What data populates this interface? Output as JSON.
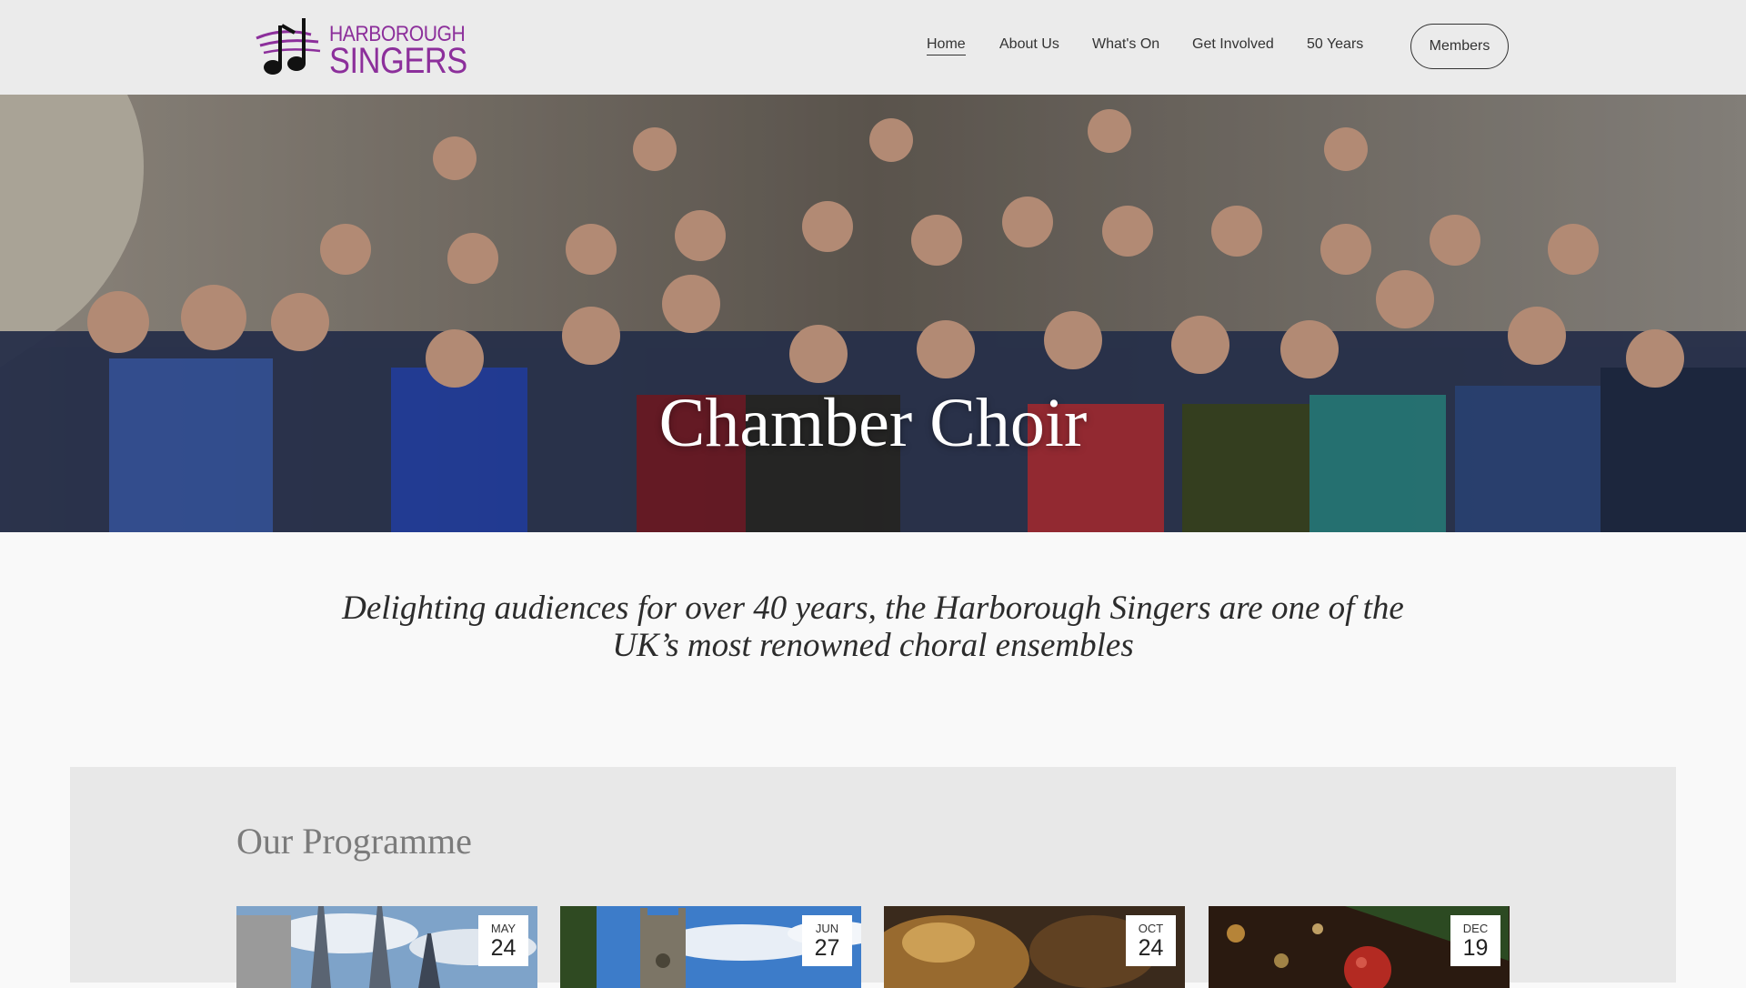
{
  "header": {
    "logo": {
      "line1": "HARBOROUGH",
      "line2": "SINGERS",
      "icon": "music-notes-icon"
    },
    "nav": [
      {
        "label": "Home",
        "active": true
      },
      {
        "label": "About Us",
        "active": false
      },
      {
        "label": "What's On",
        "active": false
      },
      {
        "label": "Get Involved",
        "active": false
      },
      {
        "label": "50 Years",
        "active": false
      }
    ],
    "members_label": "Members"
  },
  "hero": {
    "title": "Chamber Choir"
  },
  "tagline": {
    "line1": "Delighting audiences for over 40 years, the Harborough Singers are one of the",
    "line2": "UK’s most renowned choral ensembles"
  },
  "programme": {
    "title": "Our Programme",
    "events": [
      {
        "month": "MAY",
        "day": "24"
      },
      {
        "month": "JUN",
        "day": "27"
      },
      {
        "month": "OCT",
        "day": "24"
      },
      {
        "month": "DEC",
        "day": "19"
      }
    ]
  },
  "colors": {
    "brand": "#8c2f9b",
    "header_bg": "#ebebeb",
    "programme_bg": "#e8e8e8"
  }
}
